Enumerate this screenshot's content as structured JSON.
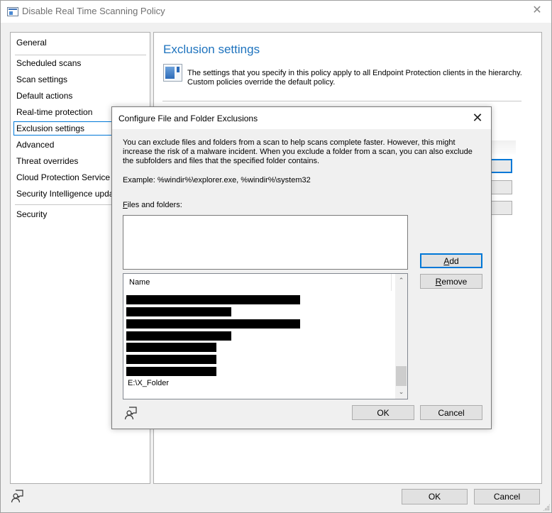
{
  "window": {
    "title": "Disable Real Time Scanning Policy",
    "close_glyph": "✕"
  },
  "nav": {
    "items": [
      {
        "label": "General"
      },
      {
        "label": "Scheduled scans"
      },
      {
        "label": "Scan settings"
      },
      {
        "label": "Default actions"
      },
      {
        "label": "Real-time protection"
      },
      {
        "label": "Exclusion settings",
        "selected": true
      },
      {
        "label": "Advanced"
      },
      {
        "label": "Threat overrides"
      },
      {
        "label": "Cloud Protection Service"
      },
      {
        "label": "Security Intelligence updates"
      },
      {
        "label": "Security"
      }
    ]
  },
  "content": {
    "heading": "Exclusion settings",
    "info_line1": "The settings that you specify in this policy apply to all Endpoint Protection clients in the hierarchy.",
    "info_line2": "Custom policies override the default policy."
  },
  "footer": {
    "ok_label": "OK",
    "cancel_label": "Cancel"
  },
  "dialog": {
    "title": "Configure File and Folder Exclusions",
    "close_glyph": "✕",
    "description": "You can exclude files and folders from a scan to help scans complete faster. However, this might increase the risk of a malware incident. When you exclude a folder from a scan, you can also exclude the subfolders and files that the specified folder contains.",
    "example": "Example: %windir%\\explorer.exe, %windir%\\system32",
    "files_label_accel": "F",
    "files_label_rest": "iles and folders:",
    "files_input_value": "",
    "add_accel": "A",
    "add_rest": "dd",
    "remove_accel": "R",
    "remove_rest": "emove",
    "list": {
      "column_header": "Name",
      "visible_item": "E:\\X_Folder",
      "redacted_rows": 7,
      "scroll_up_glyph": "⌃",
      "scroll_down_glyph": "⌄"
    },
    "ok_label": "OK",
    "cancel_label": "Cancel"
  },
  "colors": {
    "accent": "#0078d7",
    "heading": "#1e73be"
  }
}
